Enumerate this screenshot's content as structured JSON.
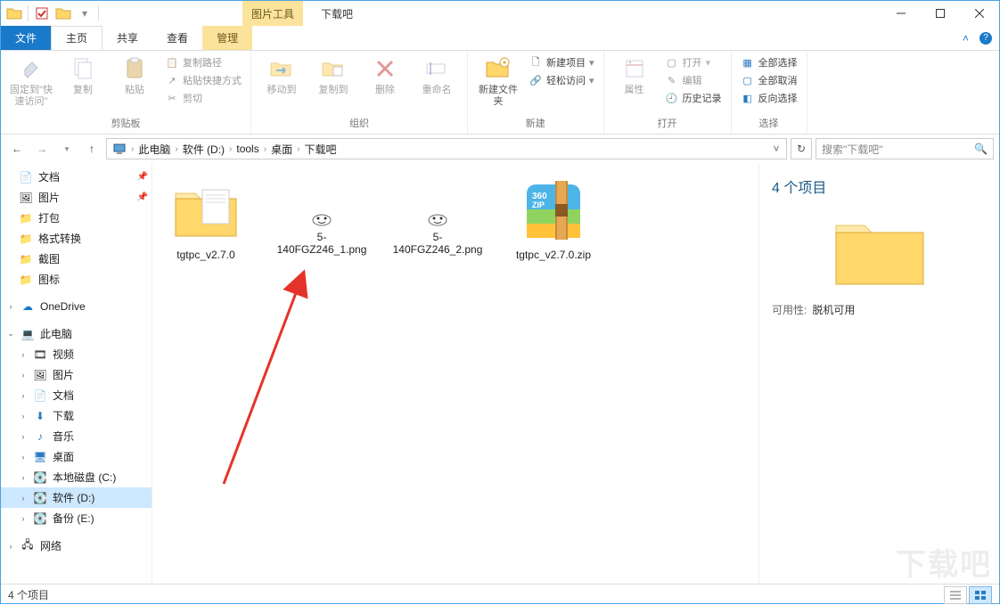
{
  "window": {
    "title": "下载吧",
    "context_tab": "图片工具"
  },
  "ribbon_tabs": {
    "file": "文件",
    "home": "主页",
    "share": "共享",
    "view": "查看",
    "manage": "管理"
  },
  "ribbon": {
    "pin": "固定到\"快速访问\"",
    "copy": "复制",
    "paste": "粘贴",
    "copy_path": "复制路径",
    "paste_shortcut": "粘贴快捷方式",
    "cut": "剪切",
    "clipboard_group": "剪贴板",
    "move_to": "移动到",
    "copy_to": "复制到",
    "delete": "删除",
    "rename": "重命名",
    "organize_group": "组织",
    "new_folder": "新建文件夹",
    "new_item": "新建项目",
    "easy_access": "轻松访问",
    "new_group": "新建",
    "properties": "属性",
    "open": "打开",
    "edit": "编辑",
    "history": "历史记录",
    "open_group": "打开",
    "select_all": "全部选择",
    "select_none": "全部取消",
    "invert": "反向选择",
    "select_group": "选择"
  },
  "breadcrumb": {
    "root": "此电脑",
    "drive": "软件 (D:)",
    "folder1": "tools",
    "folder2": "桌面",
    "folder3": "下载吧"
  },
  "search": {
    "placeholder": "搜索\"下载吧\""
  },
  "nav": {
    "docs": "文档",
    "pictures": "图片",
    "pack": "打包",
    "format": "格式转换",
    "screenshot": "截图",
    "icons": "图标",
    "onedrive": "OneDrive",
    "thispc": "此电脑",
    "video": "视频",
    "pictures2": "图片",
    "docs2": "文档",
    "downloads": "下载",
    "music": "音乐",
    "desktop": "桌面",
    "drive_c": "本地磁盘 (C:)",
    "drive_d": "软件 (D:)",
    "drive_e": "备份 (E:)",
    "network": "网络"
  },
  "files": [
    {
      "name": "tgtpc_v2.7.0",
      "type": "folder"
    },
    {
      "name": "5-140FGZ246_1.png",
      "type": "png"
    },
    {
      "name": "5-140FGZ246_2.png",
      "type": "png"
    },
    {
      "name": "tgtpc_v2.7.0.zip",
      "type": "zip"
    }
  ],
  "details": {
    "heading": "4 个项目",
    "avail_label": "可用性:",
    "avail_value": "脱机可用"
  },
  "status": {
    "count": "4 个项目"
  }
}
